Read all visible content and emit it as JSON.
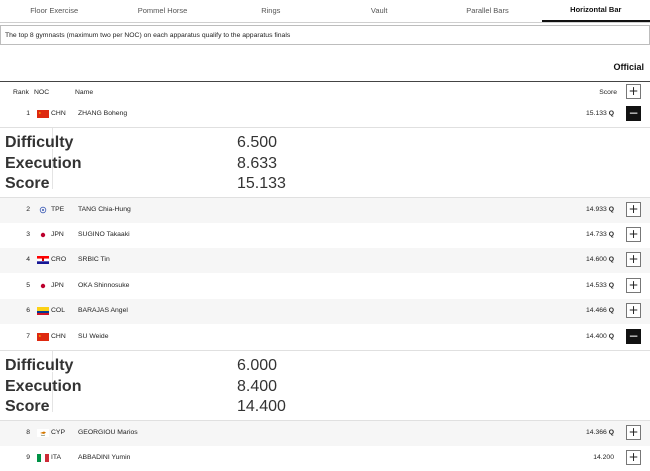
{
  "tabs": [
    "Floor Exercise",
    "Pommel Horse",
    "Rings",
    "Vault",
    "Parallel Bars",
    "Horizontal Bar"
  ],
  "active_tab": "Horizontal Bar",
  "notice": "The top 8 gymnasts (maximum two per NOC) on each apparatus qualify to the apparatus finals",
  "status": "Official",
  "header": {
    "rank": "Rank",
    "noc": "NOC",
    "name": "Name",
    "score": "Score"
  },
  "rows": [
    {
      "rank": "1",
      "noc": "CHN",
      "name": "ZHANG Boheng",
      "score": "15.133",
      "q": "Q",
      "expanded": true
    },
    {
      "rank": "2",
      "noc": "TPE",
      "name": "TANG Chia-Hung",
      "score": "14.933",
      "q": "Q"
    },
    {
      "rank": "3",
      "noc": "JPN",
      "name": "SUGINO Takaaki",
      "score": "14.733",
      "q": "Q"
    },
    {
      "rank": "4",
      "noc": "CRO",
      "name": "SRBIC Tin",
      "score": "14.600",
      "q": "Q"
    },
    {
      "rank": "5",
      "noc": "JPN",
      "name": "OKA Shinnosuke",
      "score": "14.533",
      "q": "Q"
    },
    {
      "rank": "6",
      "noc": "COL",
      "name": "BARAJAS Angel",
      "score": "14.466",
      "q": "Q"
    },
    {
      "rank": "7",
      "noc": "CHN",
      "name": "SU Weide",
      "score": "14.400",
      "q": "Q",
      "expanded": true
    },
    {
      "rank": "8",
      "noc": "CYP",
      "name": "GEORGIOU Marios",
      "score": "14.366",
      "q": "Q"
    },
    {
      "rank": "9",
      "noc": "ITA",
      "name": "ABBADINI Yumin",
      "score": "14.200",
      "q": ""
    }
  ],
  "details": {
    "labels": {
      "difficulty": "Difficulty",
      "execution": "Execution",
      "score": "Score"
    },
    "zhang": {
      "difficulty": "6.500",
      "execution": "8.633",
      "score": "15.133"
    },
    "su": {
      "difficulty": "6.000",
      "execution": "8.400",
      "score": "14.400"
    }
  },
  "icons": {
    "expand": "plus-icon",
    "collapse": "minus-icon"
  },
  "colors": {
    "active_tab_border": "#111111",
    "collapse_button": "#111111"
  }
}
